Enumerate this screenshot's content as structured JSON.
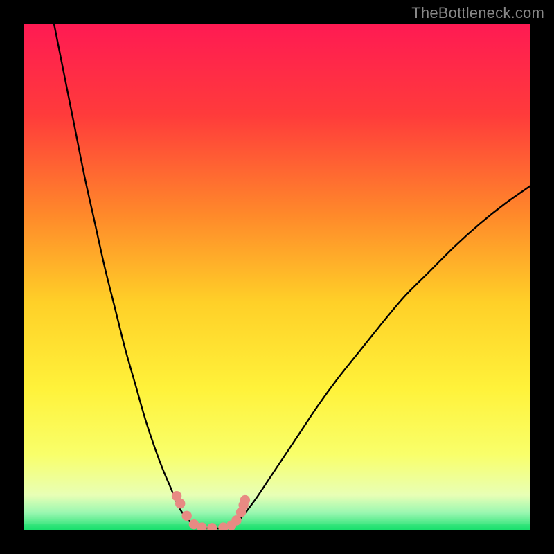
{
  "watermark": "TheBottleneck.com",
  "colors": {
    "frame": "#000000",
    "watermark": "#888888",
    "curve": "#000000",
    "marker_fill": "#e88a83",
    "marker_stroke": "#e88a83",
    "green_band": "#18e06c"
  },
  "chart_data": {
    "type": "line",
    "title": "",
    "xlabel": "",
    "ylabel": "",
    "xlim": [
      0,
      100
    ],
    "ylim": [
      0,
      100
    ],
    "grid": false,
    "legend": false,
    "series": [
      {
        "name": "left-branch",
        "x": [
          6,
          8,
          10,
          12,
          14,
          16,
          18,
          20,
          22,
          24,
          26,
          27.5,
          29,
          30,
          31,
          32,
          33,
          34
        ],
        "values": [
          100,
          90,
          80,
          70,
          61,
          52,
          44,
          36,
          29,
          22,
          16,
          12,
          8.5,
          6,
          4,
          2.6,
          1.6,
          0.9
        ]
      },
      {
        "name": "right-branch",
        "x": [
          41,
          42,
          43,
          44,
          46,
          48,
          50,
          54,
          58,
          62,
          66,
          70,
          75,
          80,
          85,
          90,
          95,
          100
        ],
        "values": [
          0.9,
          1.6,
          2.6,
          3.8,
          6.5,
          9.5,
          12.5,
          18.5,
          24.5,
          30,
          35,
          40,
          46,
          51,
          56,
          60.5,
          64.5,
          68
        ]
      },
      {
        "name": "floor",
        "x": [
          34,
          36,
          38,
          40,
          41
        ],
        "values": [
          0.9,
          0.5,
          0.4,
          0.5,
          0.9
        ]
      }
    ],
    "markers": [
      {
        "x": 30.2,
        "y": 6.8
      },
      {
        "x": 30.9,
        "y": 5.3
      },
      {
        "x": 32.2,
        "y": 2.9
      },
      {
        "x": 33.6,
        "y": 1.2
      },
      {
        "x": 35.2,
        "y": 0.6
      },
      {
        "x": 37.2,
        "y": 0.5
      },
      {
        "x": 39.4,
        "y": 0.6
      },
      {
        "x": 41.0,
        "y": 1.0
      },
      {
        "x": 42.0,
        "y": 2.0
      },
      {
        "x": 42.9,
        "y": 3.6
      },
      {
        "x": 43.4,
        "y": 5.0
      },
      {
        "x": 43.7,
        "y": 6.0
      }
    ],
    "gradient_stops": [
      {
        "offset": 0.0,
        "color": "#ff1a53"
      },
      {
        "offset": 0.18,
        "color": "#ff3b3b"
      },
      {
        "offset": 0.38,
        "color": "#ff8a2a"
      },
      {
        "offset": 0.55,
        "color": "#ffd028"
      },
      {
        "offset": 0.72,
        "color": "#fff23a"
      },
      {
        "offset": 0.85,
        "color": "#f9ff6a"
      },
      {
        "offset": 0.93,
        "color": "#e8ffb5"
      },
      {
        "offset": 0.965,
        "color": "#9af7b1"
      },
      {
        "offset": 1.0,
        "color": "#18e06c"
      }
    ]
  }
}
